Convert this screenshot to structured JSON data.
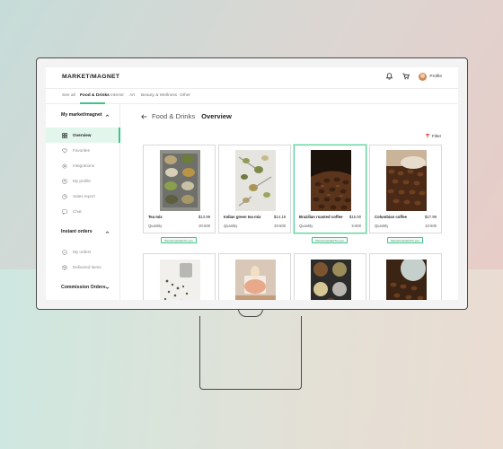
{
  "app": {
    "logo": "MARKET/MAGNET"
  },
  "header": {
    "profile_label": "Profile"
  },
  "tabs": [
    {
      "label": "See all"
    },
    {
      "label": "Food & Drinks"
    },
    {
      "label": "Interior"
    },
    {
      "label": "Art"
    },
    {
      "label": "Beauty & Wellness"
    },
    {
      "label": "Other"
    }
  ],
  "sidebar": {
    "section1": {
      "title": "My market/magnet",
      "items": [
        {
          "label": "Overview",
          "icon": "grid-icon"
        },
        {
          "label": "Favorites",
          "icon": "heart-icon"
        },
        {
          "label": "Integrations",
          "icon": "settings-icon"
        },
        {
          "label": "My profile",
          "icon": "user-icon"
        },
        {
          "label": "Sales report",
          "icon": "chart-icon"
        },
        {
          "label": "Chat",
          "icon": "chat-icon"
        }
      ]
    },
    "section2": {
      "title": "Instant orders",
      "items": [
        {
          "label": "My orders",
          "icon": "orders-icon"
        },
        {
          "label": "Delivered items",
          "icon": "delivered-icon"
        }
      ]
    },
    "section3": {
      "title": "Commission Orders"
    }
  },
  "breadcrumb": {
    "parent": "Food & Drinks",
    "current": "Overview"
  },
  "filter_label": "Filter",
  "products": [
    {
      "name": "Tea mix",
      "price": "$13.99",
      "quantity_label": "Quantity",
      "quantity": "20-500",
      "badge": "Recommended for you"
    },
    {
      "name": "Indian green tea mix",
      "price": "$14.19",
      "quantity_label": "Quantity",
      "quantity": "20-500",
      "badge": ""
    },
    {
      "name": "Brazilian roasted coffee",
      "price": "$15.00",
      "quantity_label": "Quantity",
      "quantity": "5-500",
      "badge": "Recommended for you"
    },
    {
      "name": "Columbian coffee",
      "price": "$17.99",
      "quantity_label": "Quantity",
      "quantity": "10-500",
      "badge": "Recommended for you"
    }
  ],
  "colors": {
    "accent": "#3ec48a",
    "active_bg": "#e3f6ec"
  }
}
